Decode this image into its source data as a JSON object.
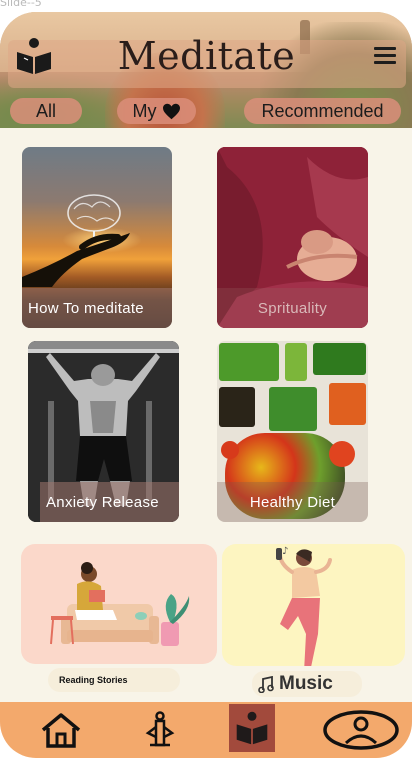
{
  "frame_label": "Slide--5",
  "header": {
    "title": "Meditate",
    "logo_icon": "book-reader-icon",
    "menu_icon": "hamburger-menu-icon"
  },
  "filters": [
    {
      "label": "All"
    },
    {
      "label": "My",
      "icon": "heart-icon"
    },
    {
      "label": "Recommended"
    }
  ],
  "cards": [
    {
      "label": "How  To meditate",
      "image": "hand-holding-brain-at-sunset"
    },
    {
      "label": "Sprituality",
      "image": "hands-in-meditation-mudra"
    },
    {
      "label": "Anxiety Release",
      "image": "man-doing-pull-ups"
    },
    {
      "label": "Healthy Diet",
      "image": "vegetable-trays"
    }
  ],
  "features": {
    "reading": {
      "label": "Reading Stories",
      "image": "person-reading-on-sofa"
    },
    "music": {
      "label": "Music",
      "icon": "music-note-icon",
      "image": "woman-dancing-with-music"
    }
  },
  "bottom_nav": [
    {
      "name": "home",
      "icon": "home-icon"
    },
    {
      "name": "meditation",
      "icon": "meditation-pose-icon"
    },
    {
      "name": "learn",
      "icon": "book-reader-icon",
      "active": true
    },
    {
      "name": "profile",
      "icon": "user-profile-icon"
    }
  ],
  "colors": {
    "background": "#f8f4e8",
    "filter_pill": "#db8e7a",
    "nav_bar": "#f3a96c",
    "nav_active": "#a24a3c",
    "reading_card": "#fbd8ca",
    "music_card": "#fdf5c1"
  }
}
